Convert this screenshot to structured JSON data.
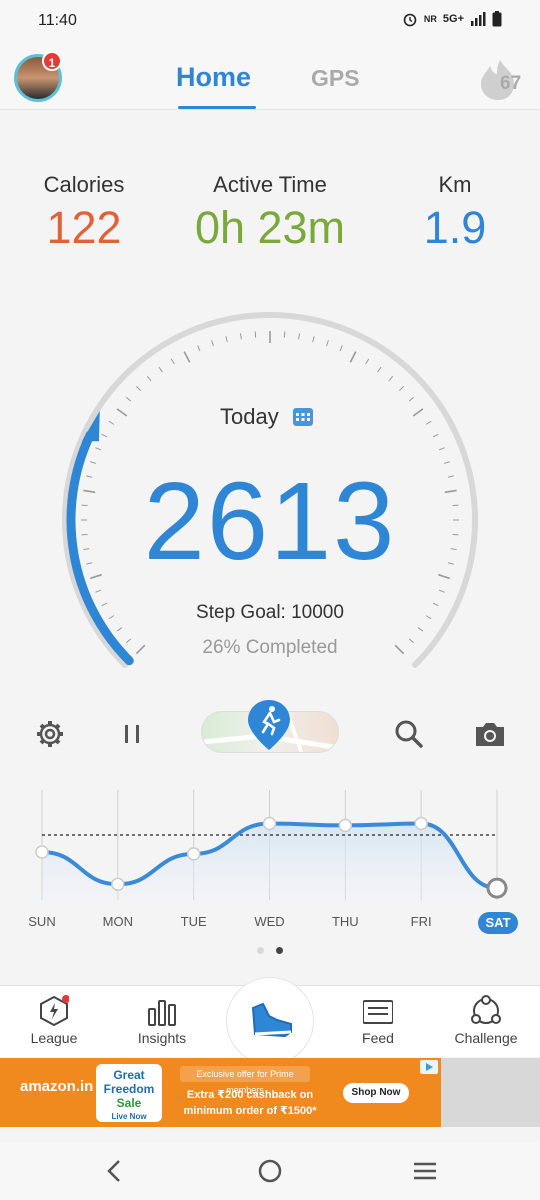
{
  "status": {
    "time": "11:40",
    "network": "5G+"
  },
  "header": {
    "tab_home": "Home",
    "tab_gps": "GPS",
    "notification_count": "1",
    "streak": "67"
  },
  "metrics": [
    {
      "label": "Calories",
      "value": "122",
      "color": "#e0623a"
    },
    {
      "label": "Active Time",
      "value": "0h 23m",
      "color": "#7aa83a"
    },
    {
      "label": "Km",
      "value": "1.9",
      "color": "#2f86d5"
    }
  ],
  "dial": {
    "title": "Today",
    "steps": "2613",
    "goal_text": "Step Goal: 10000",
    "completed_text": "26% Completed",
    "progress": 0.26
  },
  "chart_data": {
    "type": "line",
    "categories": [
      "SUN",
      "MON",
      "TUE",
      "WED",
      "THU",
      "FRI",
      "SAT"
    ],
    "values": [
      0.4,
      0.06,
      0.38,
      0.7,
      0.68,
      0.7,
      0.02
    ],
    "selected": "SAT"
  },
  "nav": {
    "league": "League",
    "insights": "Insights",
    "feed": "Feed",
    "challenge": "Challenge"
  },
  "ad": {
    "brand": "amazon.in",
    "sale_line1": "Great",
    "sale_line2": "Freedom",
    "sale_line3": "Sale",
    "sale_line4": "Live Now",
    "offer": "Exclusive offer for Prime members",
    "line1": "Extra ₹200 cashback on",
    "line2": "minimum order of ₹1500*",
    "cta": "Shop Now"
  },
  "colors": {
    "accent": "#2f86d5",
    "calories": "#e0623a",
    "active": "#7aa83a"
  }
}
